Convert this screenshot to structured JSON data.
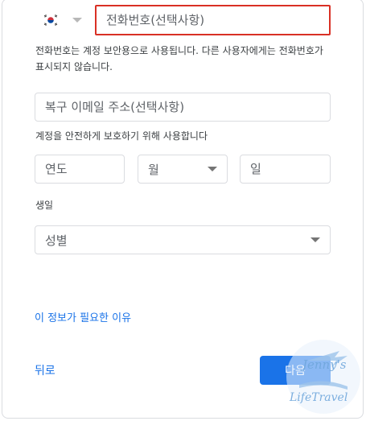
{
  "phone": {
    "country_flag": "korea-flag-icon",
    "placeholder": "전화번호(선택사항)",
    "help_text": "전화번호는 계정 보안용으로 사용됩니다. 다른 사용자에게는 전화번호가 표시되지 않습니다."
  },
  "recovery": {
    "placeholder": "복구 이메일 주소(선택사항)",
    "help_text": "계정을 안전하게 보호하기 위해 사용합니다"
  },
  "birthday": {
    "year_placeholder": "연도",
    "month_placeholder": "월",
    "day_placeholder": "일",
    "label": "생일"
  },
  "gender": {
    "placeholder": "성별"
  },
  "links": {
    "why": "이 정보가 필요한 이유",
    "back": "뒤로"
  },
  "buttons": {
    "next": "다음"
  },
  "watermark": {
    "line1": "Jenny's",
    "line2": "LifeTravel"
  },
  "colors": {
    "accent": "#1a73e8",
    "error_border": "#d93025"
  }
}
